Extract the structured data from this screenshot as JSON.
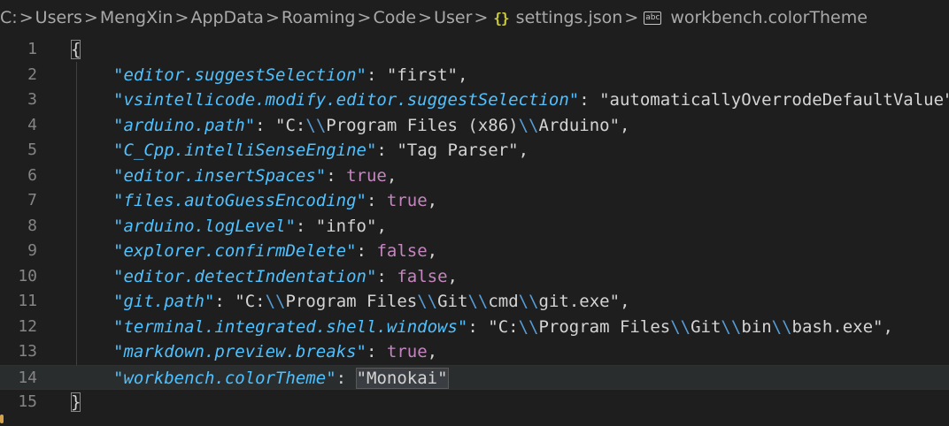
{
  "breadcrumb": {
    "items": [
      "C:",
      "Users",
      "MengXin",
      "AppData",
      "Roaming",
      "Code",
      "User",
      "settings.json",
      "workbench.colorTheme"
    ],
    "separator": ">"
  },
  "editor": {
    "lines": [
      {
        "n": "1",
        "open": "{"
      },
      {
        "n": "2",
        "key": "\"editor.suggestSelection\"",
        "value": "\"first\"",
        "type": "str",
        "comma": ","
      },
      {
        "n": "3",
        "key": "\"vsintellicode.modify.editor.suggestSelection\"",
        "value": "\"automaticallyOverrodeDefaultValue\"",
        "type": "str",
        "comma": ","
      },
      {
        "n": "4",
        "key": "\"arduino.path\"",
        "value": "\"C:\\\\Program Files (x86)\\\\Arduino\"",
        "type": "str",
        "comma": ","
      },
      {
        "n": "5",
        "key": "\"C_Cpp.intelliSenseEngine\"",
        "value": "\"Tag Parser\"",
        "type": "str",
        "comma": ","
      },
      {
        "n": "6",
        "key": "\"editor.insertSpaces\"",
        "value": "true",
        "type": "bool",
        "comma": ","
      },
      {
        "n": "7",
        "key": "\"files.autoGuessEncoding\"",
        "value": "true",
        "type": "bool",
        "comma": ","
      },
      {
        "n": "8",
        "key": "\"arduino.logLevel\"",
        "value": "\"info\"",
        "type": "str",
        "comma": ","
      },
      {
        "n": "9",
        "key": "\"explorer.confirmDelete\"",
        "value": "false",
        "type": "bool",
        "comma": ","
      },
      {
        "n": "10",
        "key": "\"editor.detectIndentation\"",
        "value": "false",
        "type": "bool",
        "comma": ","
      },
      {
        "n": "11",
        "key": "\"git.path\"",
        "value": "\"C:\\\\Program Files\\\\Git\\\\cmd\\\\git.exe\"",
        "type": "str",
        "comma": ","
      },
      {
        "n": "12",
        "key": "\"terminal.integrated.shell.windows\"",
        "value": "\"C:\\\\Program Files\\\\Git\\\\bin\\\\bash.exe\"",
        "type": "str",
        "comma": ","
      },
      {
        "n": "13",
        "key": "\"markdown.preview.breaks\"",
        "value": "true",
        "type": "bool",
        "comma": ","
      },
      {
        "n": "14",
        "key": "\"workbench.colorTheme\"",
        "value": "\"Monokai\"",
        "type": "str",
        "comma": "",
        "active": true
      },
      {
        "n": "15",
        "close": "}"
      }
    ]
  },
  "colors": {
    "background": "#1e1e1e",
    "key": "#4fc1ff",
    "boolean": "#c586c0",
    "escape": "#569cd6",
    "line_number": "#858585",
    "json_icon": "#cbcb41"
  },
  "icons": {
    "file_icon": "json-braces-icon",
    "symbol_icon": "string-abc-icon"
  }
}
